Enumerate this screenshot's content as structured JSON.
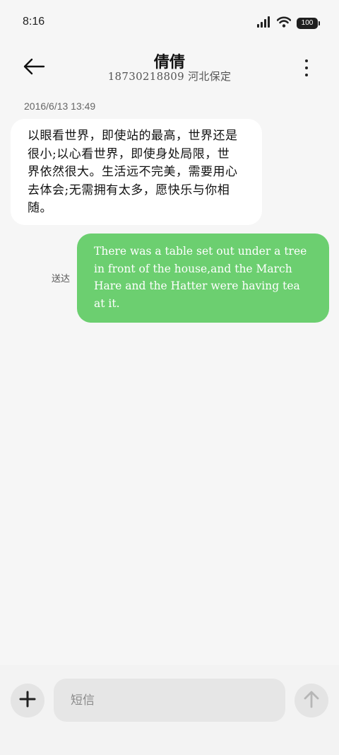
{
  "status_bar": {
    "time": "8:16",
    "battery": "100",
    "icons": [
      "signal-icon",
      "wifi-icon",
      "battery-icon"
    ]
  },
  "header": {
    "back_icon": "back-arrow-icon",
    "contact_name": "倩倩",
    "contact_detail": "18730218809 河北保定",
    "more_icon": "more-vertical-icon"
  },
  "messages": [
    {
      "direction": "incoming",
      "timestamp": "2016/6/13 13:49",
      "text": "以眼看世界，即使站的最高，世界还是很小;以心看世界，即使身处局限，世界依然很大。生活远不完美，需要用心去体会;无需拥有太多，愿快乐与你相随。"
    },
    {
      "direction": "outgoing",
      "status": "送达",
      "text": "There was a table set out under a tree in front of the house,and the March Hare and the Hatter were having tea at it."
    }
  ],
  "composer": {
    "add_icon": "plus-icon",
    "placeholder": "短信",
    "send_icon": "send-arrow-icon"
  },
  "colors": {
    "background": "#f6f6f6",
    "incoming_bubble": "#ffffff",
    "outgoing_bubble": "#6ccf70",
    "outgoing_text": "#ffffff"
  }
}
